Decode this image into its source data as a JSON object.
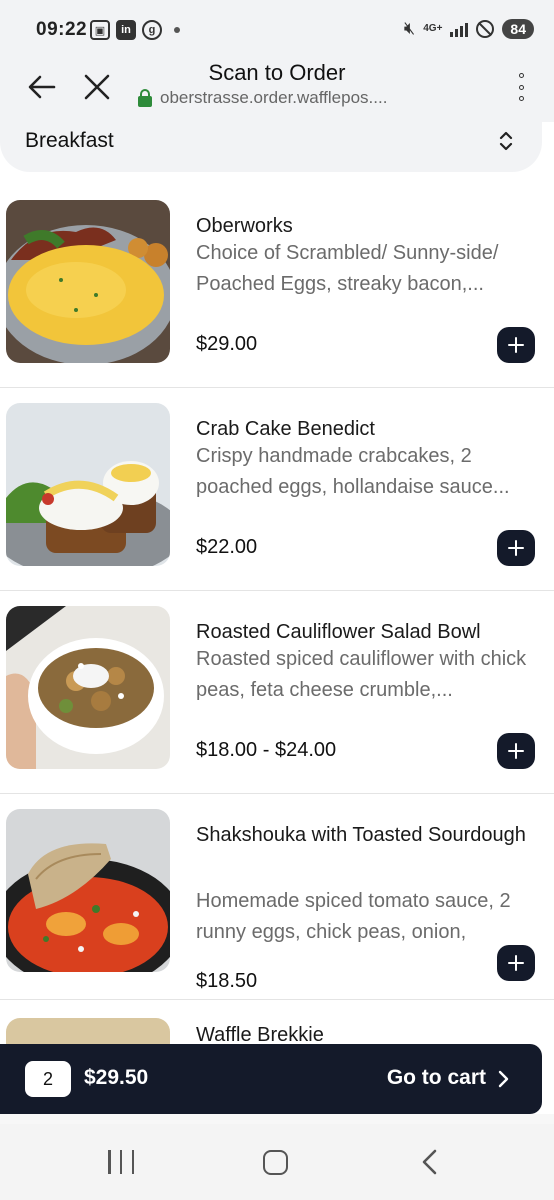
{
  "status_bar": {
    "time": "09:22",
    "battery": "84",
    "network": "4G+"
  },
  "browser": {
    "title": "Scan to Order",
    "url": "oberstrasse.order.wafflepos...."
  },
  "category": {
    "selected": "Breakfast"
  },
  "menu_items": [
    {
      "name": "Oberworks",
      "description": "Choice of Scrambled/ Sunny-side/ Poached Eggs, streaky bacon,...",
      "price": "$29.00"
    },
    {
      "name": "Crab Cake Benedict",
      "description": "Crispy handmade crabcakes, 2 poached eggs, hollandaise sauce...",
      "price": "$22.00"
    },
    {
      "name": "Roasted Cauliflower Salad Bowl",
      "description": "Roasted spiced cauliflower with chick peas, feta cheese crumble,...",
      "price": "$18.00 - $24.00"
    },
    {
      "name": "Shakshouka with Toasted Sourdough",
      "description": "Homemade spiced tomato sauce, 2 runny eggs, chick peas, onion,",
      "price": "$18.50"
    },
    {
      "name": "Waffle Brekkie"
    }
  ],
  "cart": {
    "count": "2",
    "total": "$29.50",
    "action_label": "Go to cart"
  }
}
